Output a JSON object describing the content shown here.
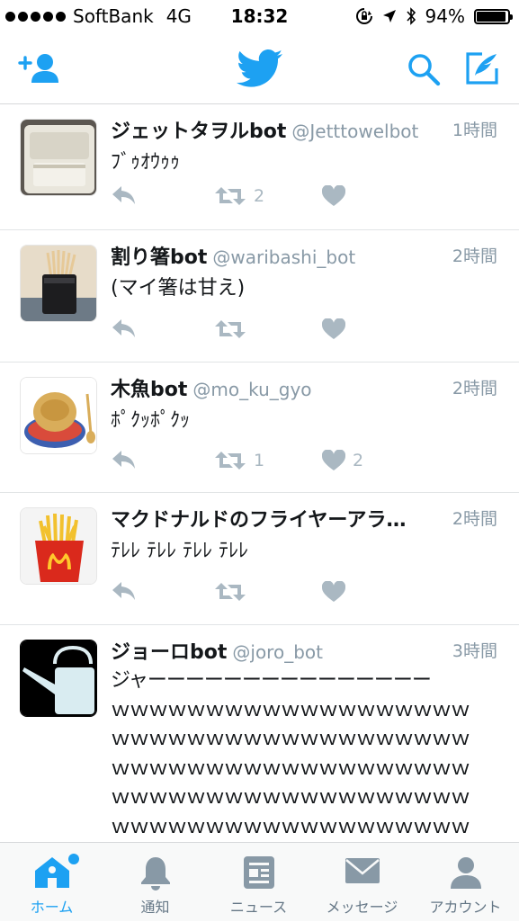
{
  "status_bar": {
    "carrier": "SoftBank",
    "network": "4G",
    "time": "18:32",
    "battery": "94%",
    "battery_level": 0.94,
    "icons": [
      "signal-dots-icon",
      "orientation-lock-icon",
      "location-arrow-icon",
      "bluetooth-icon",
      "battery-icon"
    ]
  },
  "nav": {
    "left_icon": "add-user-icon",
    "center_icon": "twitter-bird-icon",
    "right_icons": [
      "search-icon",
      "compose-tweet-icon"
    ]
  },
  "colors": {
    "accent": "#1da1f2",
    "muted": "#8899a6",
    "action": "#aab8c2",
    "text": "#14171a"
  },
  "tweets": [
    {
      "name": "ジェットタヲルbot",
      "handle": "@Jetttowelbot",
      "time": "1時間",
      "text": "ﾌﾞｩｵｳｩｩ",
      "retweets": "2",
      "likes": "",
      "avatar": "jet-towel-dryer-image"
    },
    {
      "name": "割り箸bot",
      "handle": "@waribashi_bot",
      "time": "2時間",
      "text": "(マイ箸は甘え)",
      "retweets": "",
      "likes": "",
      "avatar": "chopsticks-holder-image"
    },
    {
      "name": "木魚bot",
      "handle": "@mo_ku_gyo",
      "time": "2時間",
      "text": "ﾎﾟｸｯﾎﾟｸｯ",
      "retweets": "1",
      "likes": "2",
      "avatar": "mokugyo-image"
    },
    {
      "name": "マクドナルドのフライヤーアラ…",
      "handle": "",
      "time": "2時間",
      "text": "ﾃﾚﾚ ﾃﾚﾚ ﾃﾚﾚ ﾃﾚﾚ",
      "retweets": "",
      "likes": "",
      "avatar": "mcdonalds-fries-image"
    },
    {
      "name": "ジョーロbot",
      "handle": "@joro_bot",
      "time": "3時間",
      "text_lines": [
        "ジャーーーーーーーーーーーーーーー",
        "ｗｗｗｗｗｗｗｗｗｗｗｗｗｗｗｗｗｗｗ",
        "ｗｗｗｗｗｗｗｗｗｗｗｗｗｗｗｗｗｗｗ",
        "ｗｗｗｗｗｗｗｗｗｗｗｗｗｗｗｗｗｗｗ",
        "ｗｗｗｗｗｗｗｗｗｗｗｗｗｗｗｗｗｗｗ",
        "ｗｗｗｗｗｗｗｗｗｗｗｗｗｗｗｗｗｗｗ"
      ],
      "avatar": "watering-can-image"
    }
  ],
  "tabs": [
    {
      "label": "ホーム",
      "icon": "home-icon",
      "active": true,
      "badge": true
    },
    {
      "label": "通知",
      "icon": "bell-icon",
      "active": false
    },
    {
      "label": "ニュース",
      "icon": "news-icon",
      "active": false
    },
    {
      "label": "メッセージ",
      "icon": "envelope-icon",
      "active": false
    },
    {
      "label": "アカウント",
      "icon": "person-icon",
      "active": false
    }
  ]
}
